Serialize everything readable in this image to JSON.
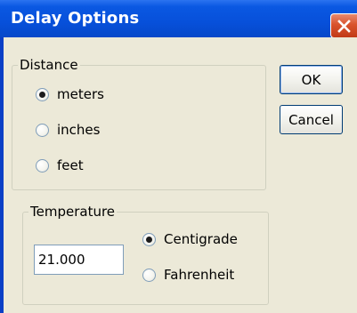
{
  "window": {
    "title": "Delay Options",
    "close_icon": "close-icon"
  },
  "distance": {
    "legend": "Distance",
    "options": [
      {
        "label": "meters",
        "checked": true
      },
      {
        "label": "inches",
        "checked": false
      },
      {
        "label": "feet",
        "checked": false
      }
    ]
  },
  "temperature": {
    "legend": "Temperature",
    "value": "21.000",
    "options": [
      {
        "label": "Centigrade",
        "checked": true
      },
      {
        "label": "Fahrenheit",
        "checked": false
      }
    ]
  },
  "buttons": {
    "ok_label": "OK",
    "cancel_label": "Cancel"
  }
}
